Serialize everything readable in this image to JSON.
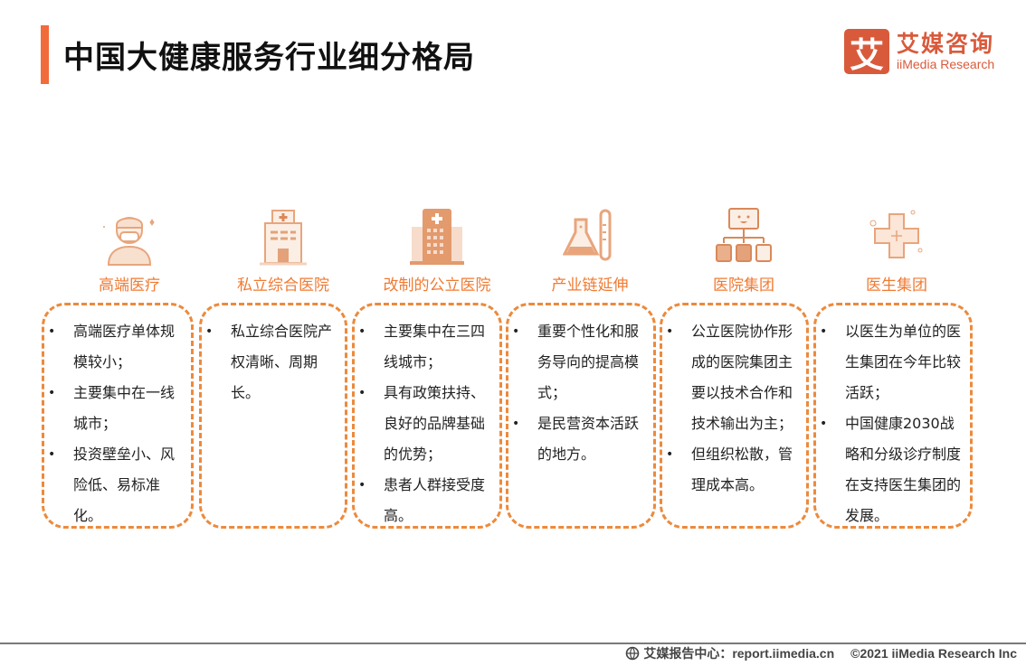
{
  "header": {
    "title": "中国大健康服务行业细分格局"
  },
  "logo": {
    "mark": "艾",
    "name_cn": "艾媒咨询",
    "name_en": "iiMedia Research"
  },
  "categories": [
    {
      "label": "高端医疗",
      "icon": "doctor-icon",
      "items": [
        "高端医疗单体规模较小；",
        "主要集中在一线城市；",
        "投资壁垒小、风险低、易标准化。"
      ]
    },
    {
      "label": "私立综合医院",
      "icon": "hospital-building-icon",
      "items": [
        "私立综合医院产权清晰、周期长。"
      ]
    },
    {
      "label": "改制的公立医院",
      "icon": "public-hospital-icon",
      "items": [
        "主要集中在三四线城市；",
        "具有政策扶持、良好的品牌基础的优势；",
        "患者人群接受度高。"
      ]
    },
    {
      "label": "产业链延伸",
      "icon": "lab-flask-icon",
      "items": [
        "重要个性化和服务导向的提高模式；",
        "是民营资本活跃的地方。"
      ]
    },
    {
      "label": "医院集团",
      "icon": "org-chart-icon",
      "items": [
        "公立医院协作形成的医院集团主要以技术合作和技术输出为主；",
        "但组织松散，管理成本高。"
      ]
    },
    {
      "label": "医生集团",
      "icon": "medical-cross-icon",
      "items": [
        "以医生为单位的医生集团在今年比较活跃；",
        "中国健康2030战略和分级诊疗制度在支持医生集团的发展。"
      ]
    }
  ],
  "footer": {
    "source_label": "艾媒报告中心：report.iimedia.cn",
    "copyright": "©2021  iiMedia Research  Inc"
  },
  "colors": {
    "accent": "#f26b3a",
    "label": "#f07a32",
    "dash": "#ec8a3c",
    "logo": "#d95a3b"
  }
}
